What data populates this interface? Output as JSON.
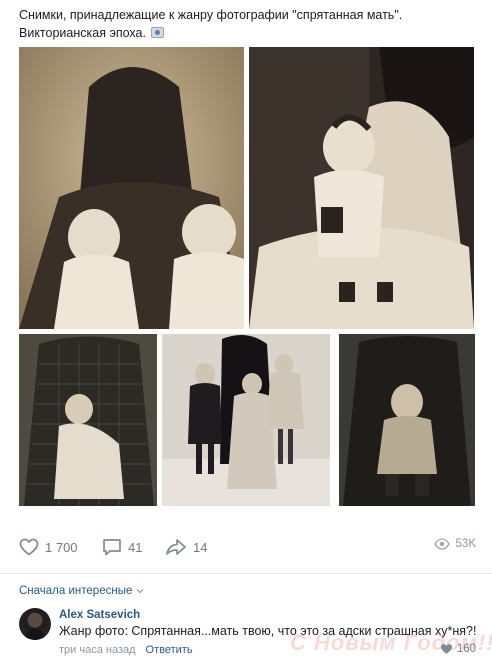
{
  "post": {
    "text": "Снимки, принадлежащие к жанру фотографии \"спрятанная мать\". Викторианская эпоха.",
    "photos": [
      {
        "name": "two-babies-hidden-mother"
      },
      {
        "name": "toddler-on-veiled-mother-lap"
      },
      {
        "name": "infant-under-veil"
      },
      {
        "name": "three-children-group"
      },
      {
        "name": "baby-on-veiled-mother"
      }
    ]
  },
  "actions": {
    "likes": "1 700",
    "comments": "41",
    "shares": "14",
    "views": "53K"
  },
  "comments": {
    "sort_label": "Сначала интересные",
    "items": [
      {
        "author": "Alex Satsevich",
        "text": "Жанр фото: Спрятанная...мать твою, что это за адски страшная ху*ня?!",
        "time": "три часа назад",
        "reply_label": "Ответить",
        "likes": "160"
      }
    ]
  },
  "watermark": "С Новым Годом!!!",
  "colors": {
    "link": "#2a5885",
    "muted": "#6e7a87",
    "sepia_light": "#d8c7a6",
    "sepia_dark": "#3a2f26"
  }
}
